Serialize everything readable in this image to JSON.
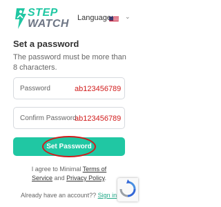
{
  "header": {
    "logo_line1": "STEP",
    "logo_line2": "WATCH",
    "language_label": "Language:",
    "language_flag": "us-flag-icon"
  },
  "form": {
    "title": "Set a password",
    "description": "The password must be more than 8 characters.",
    "password_placeholder": "Password",
    "confirm_placeholder": "Confirm Password",
    "password_annotation": "ab123456789",
    "confirm_annotation": "ab123456789",
    "submit_label": "Set Password"
  },
  "terms": {
    "prefix": "I agree to Minimal ",
    "terms_link": "Terms of Service",
    "joiner": " and ",
    "privacy_link": "Privacy Policy",
    "suffix": "."
  },
  "signin": {
    "text": "Already have an account?? ",
    "link": "Sign in"
  },
  "colors": {
    "accent": "#20c7a3",
    "annotation": "#d11b1b"
  },
  "icons": [
    "running-man-logo-icon",
    "us-flag-icon",
    "chevron-down-icon",
    "recaptcha-icon"
  ]
}
